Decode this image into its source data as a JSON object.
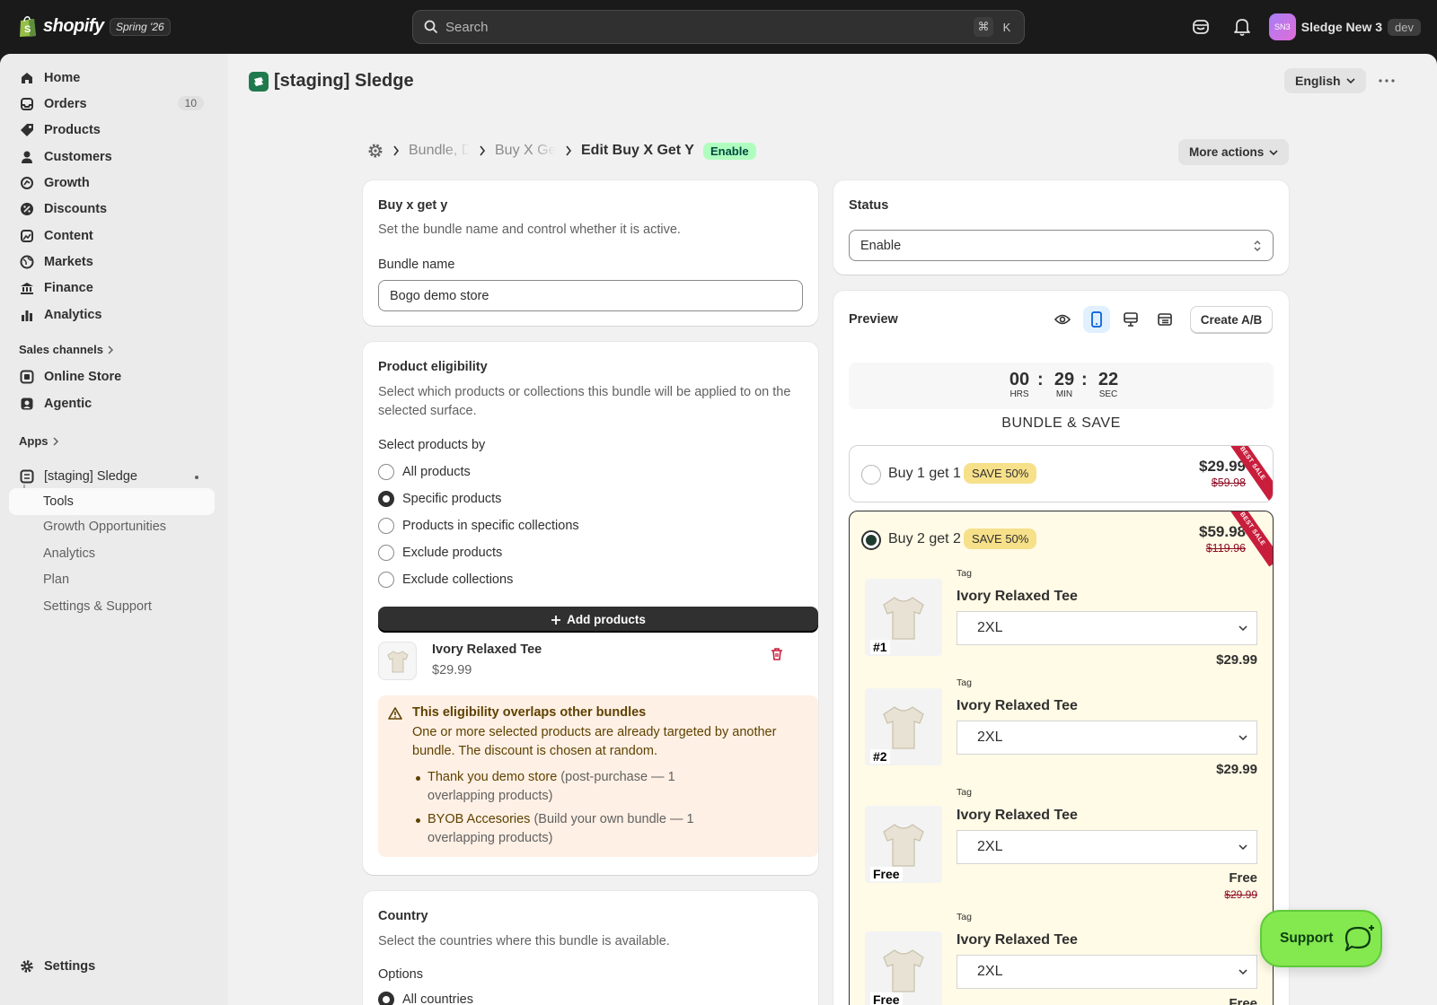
{
  "topbar": {
    "brand": "shopify",
    "edition": "Spring '26",
    "search_placeholder": "Search",
    "shortcut_cmd": "⌘",
    "shortcut_key": "K",
    "avatar_initials": "SN3",
    "store_name": "Sledge New 3",
    "env_badge": "dev"
  },
  "sidebar": {
    "items": [
      {
        "label": "Home",
        "icon": "home-icon"
      },
      {
        "label": "Orders",
        "icon": "orders-icon",
        "count": "10"
      },
      {
        "label": "Products",
        "icon": "tag-icon"
      },
      {
        "label": "Customers",
        "icon": "person-icon"
      },
      {
        "label": "Growth",
        "icon": "growth-icon"
      },
      {
        "label": "Discounts",
        "icon": "discount-icon"
      },
      {
        "label": "Content",
        "icon": "content-icon"
      },
      {
        "label": "Markets",
        "icon": "globe-icon"
      },
      {
        "label": "Finance",
        "icon": "bank-icon"
      },
      {
        "label": "Analytics",
        "icon": "bar-chart-icon"
      }
    ],
    "sales_channels_label": "Sales channels",
    "channels": [
      {
        "label": "Online Store",
        "icon": "store-icon"
      },
      {
        "label": "Agentic",
        "icon": "agentic-icon"
      }
    ],
    "apps_label": "Apps",
    "app_name": "[staging] Sledge",
    "app_sub": [
      "Tools",
      "Growth Opportunities",
      "Analytics",
      "Plan",
      "Settings & Support"
    ],
    "settings_label": "Settings"
  },
  "header": {
    "app_title": "[staging] Sledge",
    "language": "English"
  },
  "breadcrumb": {
    "items": [
      "Bundle, Discounts",
      "Buy X Get Y"
    ],
    "current": "Edit Buy X Get Y",
    "status_pill": "Enable",
    "more_actions": "More actions"
  },
  "bundle_card": {
    "title": "Buy x get y",
    "description": "Set the bundle name and control whether it is active.",
    "name_label": "Bundle name",
    "name_value": "Bogo demo store"
  },
  "eligibility": {
    "title": "Product eligibility",
    "description": "Select which products or collections this bundle will be applied to on the selected surface.",
    "select_label": "Select products by",
    "options": [
      "All products",
      "Specific products",
      "Products in specific collections",
      "Exclude products",
      "Exclude collections"
    ],
    "selected_index": 1,
    "add_button": "Add products",
    "product_name": "Ivory Relaxed Tee",
    "product_price": "$29.99",
    "warning_title": "This eligibility overlaps other bundles",
    "warning_body": "One or more selected products are already targeted by another bundle. The discount is chosen at random.",
    "overlaps": [
      {
        "name": "Thank you demo store",
        "detail": " (post-purchase — 1 overlapping products)"
      },
      {
        "name": "BYOB Accesories",
        "detail": " (Build your own bundle — 1 overlapping products)"
      }
    ]
  },
  "country": {
    "title": "Country",
    "description": "Select the countries where this bundle is available.",
    "options_label": "Options",
    "first_option": "All countries"
  },
  "status_card": {
    "title": "Status",
    "value": "Enable"
  },
  "preview": {
    "title": "Preview",
    "create_ab": "Create A/B",
    "timer": {
      "hours": "00",
      "minutes": "29",
      "seconds": "22",
      "hrs_label": "HRS",
      "min_label": "MIN",
      "sec_label": "SEC"
    },
    "heading": "BUNDLE & SAVE",
    "ribbon": "BEST SALE",
    "offers": [
      {
        "title": "Buy 1 get 1",
        "save": "SAVE 50%",
        "price": "$29.99",
        "old_price": "$59.98"
      },
      {
        "title": "Buy 2 get 2",
        "save": "SAVE 50%",
        "price": "$59.98",
        "old_price": "$119.96"
      }
    ],
    "items": [
      {
        "badge": "#1",
        "tag": "Tag",
        "name": "Ivory Relaxed Tee",
        "size": "2XL",
        "price": "$29.99",
        "old_price": ""
      },
      {
        "badge": "#2",
        "tag": "Tag",
        "name": "Ivory Relaxed Tee",
        "size": "2XL",
        "price": "$29.99",
        "old_price": ""
      },
      {
        "badge": "Free",
        "tag": "Tag",
        "name": "Ivory Relaxed Tee",
        "size": "2XL",
        "price": "Free",
        "old_price": "$29.99"
      },
      {
        "badge": "Free",
        "tag": "Tag",
        "name": "Ivory Relaxed Tee",
        "size": "2XL",
        "price": "Free",
        "old_price": ""
      }
    ]
  },
  "support_button": "Support",
  "colors": {
    "accent": "#303030",
    "success_pill": "#affebf",
    "warning_bg": "#fff0e5",
    "save_pill": "#f7e08a",
    "ribbon": "#c81e3c",
    "support": "#84e84f"
  }
}
